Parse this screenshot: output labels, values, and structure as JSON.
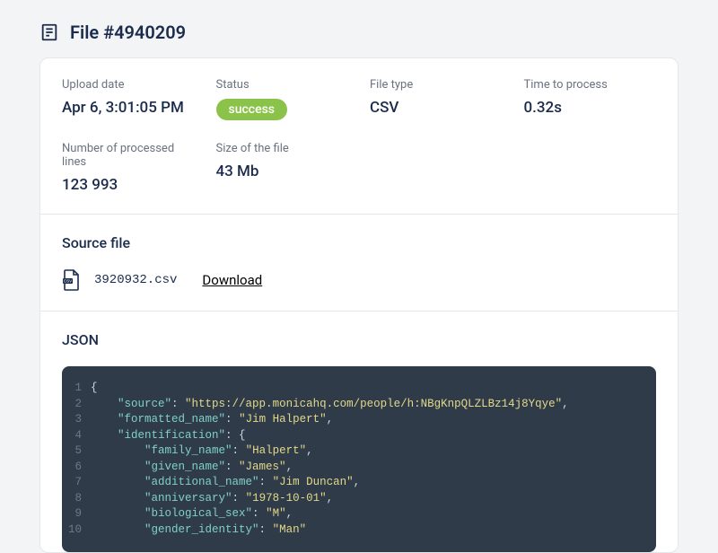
{
  "page_title": "File #4940209",
  "stats": {
    "upload_date": {
      "label": "Upload date",
      "value": "Apr 6, 3:01:05 PM"
    },
    "status": {
      "label": "Status",
      "value": "success"
    },
    "file_type": {
      "label": "File type",
      "value": "CSV"
    },
    "time_to_process": {
      "label": "Time to process",
      "value": "0.32s"
    },
    "lines": {
      "label": "Number of processed lines",
      "value": "123 993"
    },
    "size": {
      "label": "Size of the file",
      "value": "43 Mb"
    }
  },
  "source": {
    "heading": "Source file",
    "filename": "3920932.csv",
    "download_label": "Download"
  },
  "json_section": {
    "heading": "JSON",
    "lines": [
      {
        "n": "1",
        "tokens": [
          {
            "t": "{",
            "c": "punc"
          }
        ]
      },
      {
        "n": "2",
        "tokens": [
          {
            "t": "    ",
            "c": "punc"
          },
          {
            "t": "\"source\"",
            "c": "key"
          },
          {
            "t": ": ",
            "c": "punc"
          },
          {
            "t": "\"https://app.monicahq.com/people/h:NBgKnpQLZLBz14j8Yqye\"",
            "c": "str"
          },
          {
            "t": ",",
            "c": "punc"
          }
        ]
      },
      {
        "n": "3",
        "tokens": [
          {
            "t": "    ",
            "c": "punc"
          },
          {
            "t": "\"formatted_name\"",
            "c": "key"
          },
          {
            "t": ": ",
            "c": "punc"
          },
          {
            "t": "\"Jim Halpert\"",
            "c": "str"
          },
          {
            "t": ",",
            "c": "punc"
          }
        ]
      },
      {
        "n": "4",
        "tokens": [
          {
            "t": "    ",
            "c": "punc"
          },
          {
            "t": "\"identification\"",
            "c": "key"
          },
          {
            "t": ": {",
            "c": "punc"
          }
        ]
      },
      {
        "n": "5",
        "tokens": [
          {
            "t": "        ",
            "c": "punc"
          },
          {
            "t": "\"family_name\"",
            "c": "key"
          },
          {
            "t": ": ",
            "c": "punc"
          },
          {
            "t": "\"Halpert\"",
            "c": "str"
          },
          {
            "t": ",",
            "c": "punc"
          }
        ]
      },
      {
        "n": "6",
        "tokens": [
          {
            "t": "        ",
            "c": "punc"
          },
          {
            "t": "\"given_name\"",
            "c": "key"
          },
          {
            "t": ": ",
            "c": "punc"
          },
          {
            "t": "\"James\"",
            "c": "str"
          },
          {
            "t": ",",
            "c": "punc"
          }
        ]
      },
      {
        "n": "7",
        "tokens": [
          {
            "t": "        ",
            "c": "punc"
          },
          {
            "t": "\"additional_name\"",
            "c": "key"
          },
          {
            "t": ": ",
            "c": "punc"
          },
          {
            "t": "\"Jim Duncan\"",
            "c": "str"
          },
          {
            "t": ",",
            "c": "punc"
          }
        ]
      },
      {
        "n": "8",
        "tokens": [
          {
            "t": "        ",
            "c": "punc"
          },
          {
            "t": "\"anniversary\"",
            "c": "key"
          },
          {
            "t": ": ",
            "c": "punc"
          },
          {
            "t": "\"1978-10-01\"",
            "c": "str"
          },
          {
            "t": ",",
            "c": "punc"
          }
        ]
      },
      {
        "n": "9",
        "tokens": [
          {
            "t": "        ",
            "c": "punc"
          },
          {
            "t": "\"biological_sex\"",
            "c": "key"
          },
          {
            "t": ": ",
            "c": "punc"
          },
          {
            "t": "\"M\"",
            "c": "str"
          },
          {
            "t": ",",
            "c": "punc"
          }
        ]
      },
      {
        "n": "10",
        "tokens": [
          {
            "t": "        ",
            "c": "punc"
          },
          {
            "t": "\"gender_identity\"",
            "c": "key"
          },
          {
            "t": ": ",
            "c": "punc"
          },
          {
            "t": "\"Man\"",
            "c": "str"
          }
        ]
      }
    ]
  }
}
